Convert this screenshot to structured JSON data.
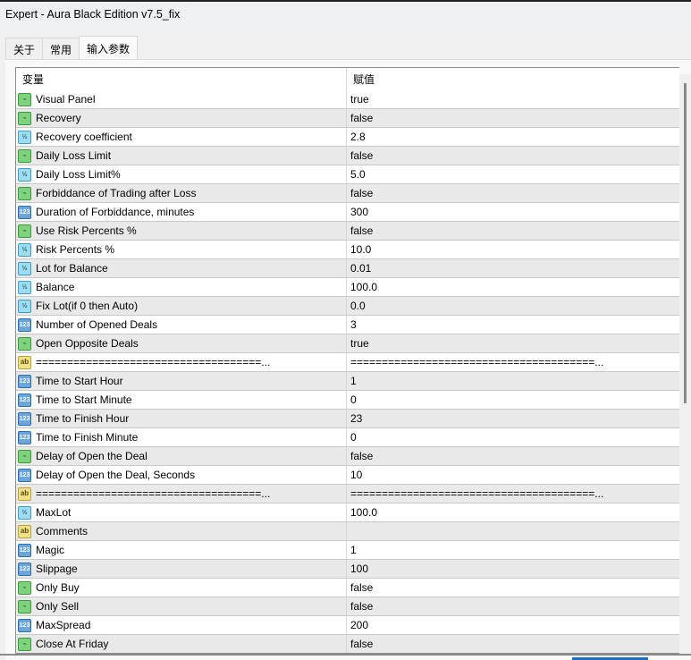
{
  "window": {
    "title": "Expert - Aura Black Edition v7.5_fix"
  },
  "tabs": [
    {
      "label": "关于"
    },
    {
      "label": "常用"
    },
    {
      "label": "输入参数",
      "active": true
    }
  ],
  "table": {
    "headers": {
      "variable": "变量",
      "value": "赋值"
    },
    "rows": [
      {
        "type": "bool",
        "name": "Visual Panel",
        "value": "true"
      },
      {
        "type": "bool",
        "name": "Recovery",
        "value": "false"
      },
      {
        "type": "double",
        "name": "Recovery coefficient",
        "value": "2.8"
      },
      {
        "type": "bool",
        "name": "Daily Loss Limit",
        "value": "false"
      },
      {
        "type": "double",
        "name": "Daily Loss Limit%",
        "value": "5.0"
      },
      {
        "type": "bool",
        "name": "Forbiddance of Trading after Loss",
        "value": "false"
      },
      {
        "type": "int",
        "name": "Duration of Forbiddance, minutes",
        "value": "300"
      },
      {
        "type": "bool",
        "name": "Use Risk Percents %",
        "value": "false"
      },
      {
        "type": "double",
        "name": "Risk Percents %",
        "value": "10.0"
      },
      {
        "type": "double",
        "name": "Lot for Balance",
        "value": "0.01"
      },
      {
        "type": "double",
        "name": "Balance",
        "value": "100.0"
      },
      {
        "type": "double",
        "name": "Fix Lot(if 0 then Auto)",
        "value": "0.0"
      },
      {
        "type": "int",
        "name": "Number of Opened Deals",
        "value": "3"
      },
      {
        "type": "bool",
        "name": "Open Opposite Deals",
        "value": "true"
      },
      {
        "type": "string",
        "name": "====================================...",
        "value": "=======================================..."
      },
      {
        "type": "int",
        "name": "Time to Start Hour",
        "value": "1"
      },
      {
        "type": "int",
        "name": "Time to Start Minute",
        "value": "0"
      },
      {
        "type": "int",
        "name": "Time to Finish Hour",
        "value": "23"
      },
      {
        "type": "int",
        "name": "Time to Finish Minute",
        "value": "0"
      },
      {
        "type": "bool",
        "name": "Delay of Open the Deal",
        "value": "false"
      },
      {
        "type": "int",
        "name": "Delay of Open the Deal, Seconds",
        "value": "10"
      },
      {
        "type": "string",
        "name": "====================================...",
        "value": "=======================================..."
      },
      {
        "type": "double",
        "name": "MaxLot",
        "value": "100.0"
      },
      {
        "type": "string",
        "name": "Comments",
        "value": ""
      },
      {
        "type": "int",
        "name": "Magic",
        "value": "1"
      },
      {
        "type": "int",
        "name": "Slippage",
        "value": "100"
      },
      {
        "type": "bool",
        "name": "Only Buy",
        "value": "false"
      },
      {
        "type": "bool",
        "name": "Only Sell",
        "value": "false"
      },
      {
        "type": "int",
        "name": "MaxSpread",
        "value": "200"
      },
      {
        "type": "bool",
        "name": "Close At Friday",
        "value": "false"
      }
    ]
  },
  "icon_glyphs": {
    "bool": "⌁",
    "double": "½",
    "int": "123",
    "string": "ab"
  }
}
